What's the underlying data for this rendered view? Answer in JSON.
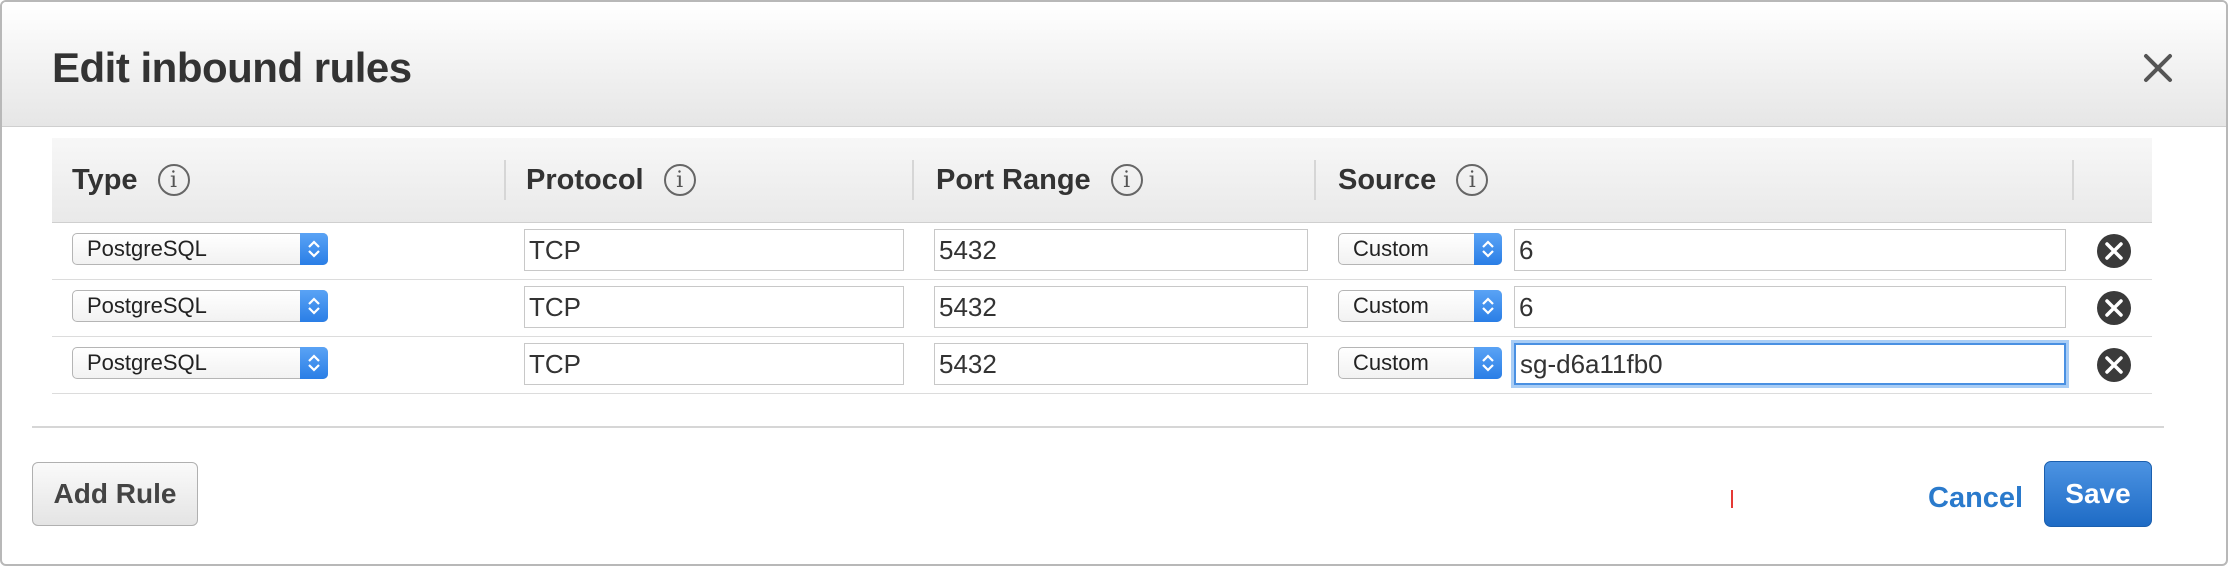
{
  "dialog": {
    "title": "Edit inbound rules",
    "close_icon": "close-icon"
  },
  "table": {
    "columns": [
      {
        "label": "Type"
      },
      {
        "label": "Protocol"
      },
      {
        "label": "Port Range"
      },
      {
        "label": "Source"
      }
    ],
    "info_glyph": "i",
    "rows": [
      {
        "type": "PostgreSQL",
        "protocol": "TCP",
        "port_range": "5432",
        "source_type": "Custom",
        "source_value": "6"
      },
      {
        "type": "PostgreSQL",
        "protocol": "TCP",
        "port_range": "5432",
        "source_type": "Custom",
        "source_value": "6"
      },
      {
        "type": "PostgreSQL",
        "protocol": "TCP",
        "port_range": "5432",
        "source_type": "Custom",
        "source_value": "sg-d6a11fb0"
      }
    ]
  },
  "footer": {
    "add_rule_label": "Add Rule",
    "cancel_label": "Cancel",
    "save_label": "Save"
  },
  "colors": {
    "primary": "#2a7ee6",
    "link": "#2a7acc",
    "focus": "#4a90e2"
  }
}
